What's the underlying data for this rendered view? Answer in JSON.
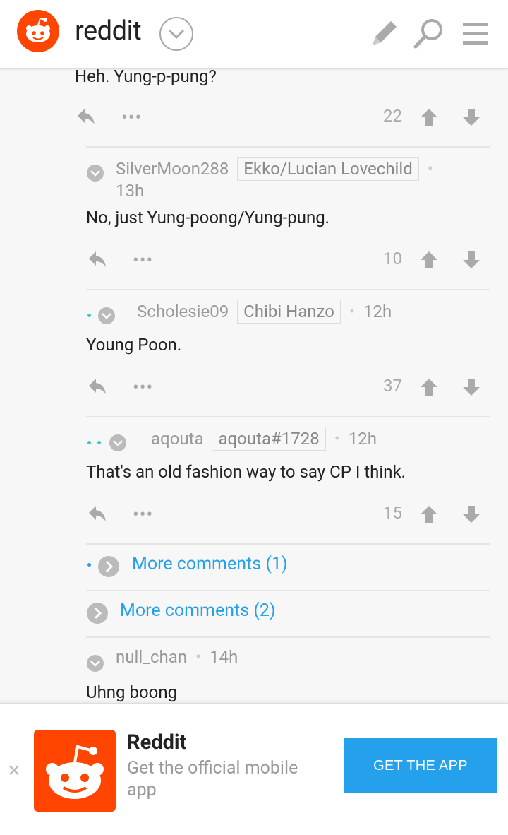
{
  "header": {
    "brand": "reddit",
    "icons": [
      "reddit-logo-icon",
      "chevron-down-icon",
      "pencil-icon",
      "search-icon",
      "menu-icon"
    ]
  },
  "comments": [
    {
      "text": "Heh. Yung-p-pung?",
      "score": "22"
    },
    {
      "author": "SilverMoon288",
      "flair": "Ekko/Lucian Lovechild",
      "time": "13h",
      "text": "No, just Yung-poong/Yung-pung.",
      "score": "10"
    },
    {
      "author": "Scholesie09",
      "flair": "Chibi Hanzo",
      "time": "12h",
      "text": "Young Poon.",
      "score": "37"
    },
    {
      "author": "aqouta",
      "flair": "aqouta#1728",
      "time": "12h",
      "text": "That's an old fashion way to say CP I think.",
      "score": "15"
    },
    {
      "author": "null_chan",
      "time": "14h",
      "text": "Uhng boong"
    }
  ],
  "more": [
    {
      "label": "More comments (1)"
    },
    {
      "label": "More comments (2)"
    }
  ],
  "separator": "•",
  "ellipsis": "•••",
  "banner": {
    "title": "Reddit",
    "subtitle": "Get the official mobile app",
    "cta": "GET THE APP",
    "close": "×"
  },
  "colors": {
    "brand_orange": "#ff4500",
    "link_blue": "#24a0ed",
    "depth_teal": "#33cccc"
  }
}
